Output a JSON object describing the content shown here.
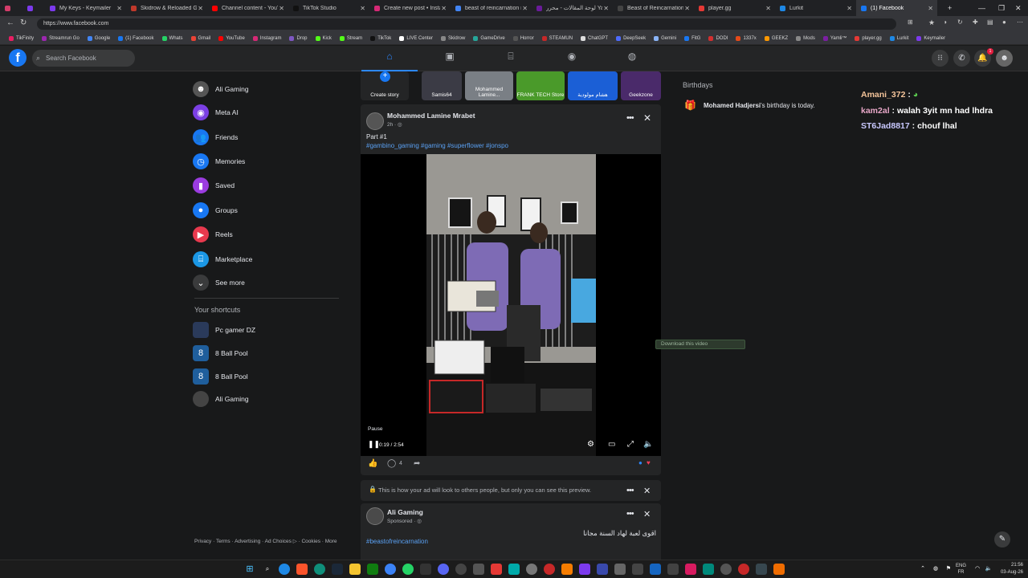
{
  "browser": {
    "tabs": [
      {
        "label": "",
        "color": "#d33c6a"
      },
      {
        "label": "",
        "color": "#7c3aed"
      },
      {
        "label": "My Keys - Keymailer",
        "color": "#7c3aed"
      },
      {
        "label": "Skidrow & Reloaded Games",
        "color": "#c0392b"
      },
      {
        "label": "Channel content - YouTube",
        "color": "#ff0000"
      },
      {
        "label": "TikTok Studio",
        "color": "#111111"
      },
      {
        "label": "Create new post • Instagram",
        "color": "#d62976"
      },
      {
        "label": "beast of reincarnation nam",
        "color": "#4285f4"
      },
      {
        "label": "لوحة المقالات - محرر Yamli™",
        "color": "#6a1b9a"
      },
      {
        "label": "Beast of Reincarnation Has",
        "color": "#444444"
      },
      {
        "label": "player.gg",
        "color": "#e53935"
      },
      {
        "label": "Lurkit",
        "color": "#1e88e5"
      },
      {
        "label": "(1) Facebook",
        "color": "#1877f2"
      }
    ],
    "active_tab_index": 12,
    "url": "https://www.facebook.com",
    "bookmarks": [
      {
        "label": "TikFinity",
        "color": "#e91e63"
      },
      {
        "label": "Streamrun Go",
        "color": "#9c27b0"
      },
      {
        "label": "Google",
        "color": "#4285f4"
      },
      {
        "label": "(1) Facebook",
        "color": "#1877f2"
      },
      {
        "label": "Whats",
        "color": "#25d366"
      },
      {
        "label": "Gmail",
        "color": "#ea4335"
      },
      {
        "label": "YouTube",
        "color": "#ff0000"
      },
      {
        "label": "Instagram",
        "color": "#d62976"
      },
      {
        "label": "Drop",
        "color": "#7e57c2"
      },
      {
        "label": "Kick",
        "color": "#53fc18"
      },
      {
        "label": "Stream",
        "color": "#53fc18"
      },
      {
        "label": "TikTok",
        "color": "#111111"
      },
      {
        "label": "LIVE Center",
        "color": "#ffffff"
      },
      {
        "label": "Skidrow",
        "color": "#888888"
      },
      {
        "label": "GameDrive",
        "color": "#26a69a"
      },
      {
        "label": "Horror",
        "color": "#555555"
      },
      {
        "label": "STEAMUN",
        "color": "#c62828"
      },
      {
        "label": "ChatGPT",
        "color": "#dddddd"
      },
      {
        "label": "DeepSeek",
        "color": "#4d6bfe"
      },
      {
        "label": "Gemini",
        "color": "#8ab4f8"
      },
      {
        "label": "FitG",
        "color": "#1877f2"
      },
      {
        "label": "DODI",
        "color": "#d32f2f"
      },
      {
        "label": "1337x",
        "color": "#e64a19"
      },
      {
        "label": "GEEKZ",
        "color": "#ff9800"
      },
      {
        "label": "Mods",
        "color": "#888888"
      },
      {
        "label": "Yamli™",
        "color": "#7b1fa2"
      },
      {
        "label": "player.gg",
        "color": "#e53935"
      },
      {
        "label": "Lurkit",
        "color": "#1e88e5"
      },
      {
        "label": "Keymailer",
        "color": "#7c3aed"
      }
    ]
  },
  "fb": {
    "logo": "f",
    "search_placeholder": "Search Facebook",
    "notif_count": "1",
    "accent": "#1877f2"
  },
  "leftnav": {
    "items": [
      {
        "label": "Ali Gaming",
        "icon": "avatar",
        "color": "#555555"
      },
      {
        "label": "Meta AI",
        "icon": "meta-ai-icon",
        "color": "#7b3fe4"
      },
      {
        "label": "Friends",
        "icon": "friends-icon",
        "color": "#1877f2"
      },
      {
        "label": "Memories",
        "icon": "clock-icon",
        "color": "#1877f2"
      },
      {
        "label": "Saved",
        "icon": "bookmark-icon",
        "color": "#9b3ce0"
      },
      {
        "label": "Groups",
        "icon": "groups-icon",
        "color": "#1877f2"
      },
      {
        "label": "Reels",
        "icon": "reels-icon",
        "color": "#e8394e"
      },
      {
        "label": "Marketplace",
        "icon": "marketplace-icon",
        "color": "#1b97e5"
      },
      {
        "label": "See more",
        "icon": "chevron-down-icon",
        "color": "#3a3b3c"
      }
    ],
    "shortcuts_title": "Your shortcuts",
    "shortcuts": [
      {
        "label": "Pc gamer DZ",
        "color": "#2a3a5a"
      },
      {
        "label": "8 Ball Pool",
        "color": "#1f5e9c"
      },
      {
        "label": "8 Ball Pool",
        "color": "#1f5e9c"
      },
      {
        "label": "Ali Gaming",
        "color": "#444444"
      }
    ],
    "footer": "Privacy · Terms · Advertising · Ad Choices ▷ · Cookies · More"
  },
  "stories": [
    {
      "label": "Create story",
      "color": "#242526"
    },
    {
      "label": "Samis64",
      "color": "#3b3b45"
    },
    {
      "label": "Mohammed Lamine...",
      "color": "#7a7f85"
    },
    {
      "label": "FRANK TECH Store",
      "color": "#4a9a2a"
    },
    {
      "label": "هشام مولودية",
      "color": "#1b5fd6"
    },
    {
      "label": "Geekzone",
      "color": "#4a2a6a"
    }
  ],
  "post": {
    "author": "Mohammed Lamine Mrabet",
    "time": "2h · ◎",
    "line1": "Part #1",
    "tags": "#gambino_gaming #gaming #superflower #jonspo",
    "pause_label": "Pause",
    "video_time": "0:19 / 2:54",
    "comment_count": "4"
  },
  "ad_notice": {
    "text": "This is how your ad will look to others people, but only you can see this preview."
  },
  "ad_post": {
    "author": "Ali Gaming",
    "sponsored": "Sponsored · ◎",
    "arabic_text": "اقوى لعبة لهاد السنة مجانا",
    "tag": "#beastofreincarnation"
  },
  "birthdays": {
    "title": "Birthdays",
    "name": "Mohamed Hadjersi",
    "suffix": "'s birthday is today."
  },
  "chat": [
    {
      "user": "Amani_372",
      "sep": " :",
      "msg": "",
      "color": "#f4c49a",
      "emoji": true
    },
    {
      "user": "kam2al",
      "sep": " : ",
      "msg": "walah 3yit mn had lhdra",
      "color": "#e8a7c8"
    },
    {
      "user": "ST6Jad8817",
      "sep": " : ",
      "msg": "chouf lhal",
      "color": "#c9c9ff"
    }
  ],
  "download_pill": "Download this video",
  "taskbar": {
    "lang_top": "ENG",
    "lang_bottom": "FR",
    "time": "21:56",
    "date": "03-Aug-26"
  }
}
